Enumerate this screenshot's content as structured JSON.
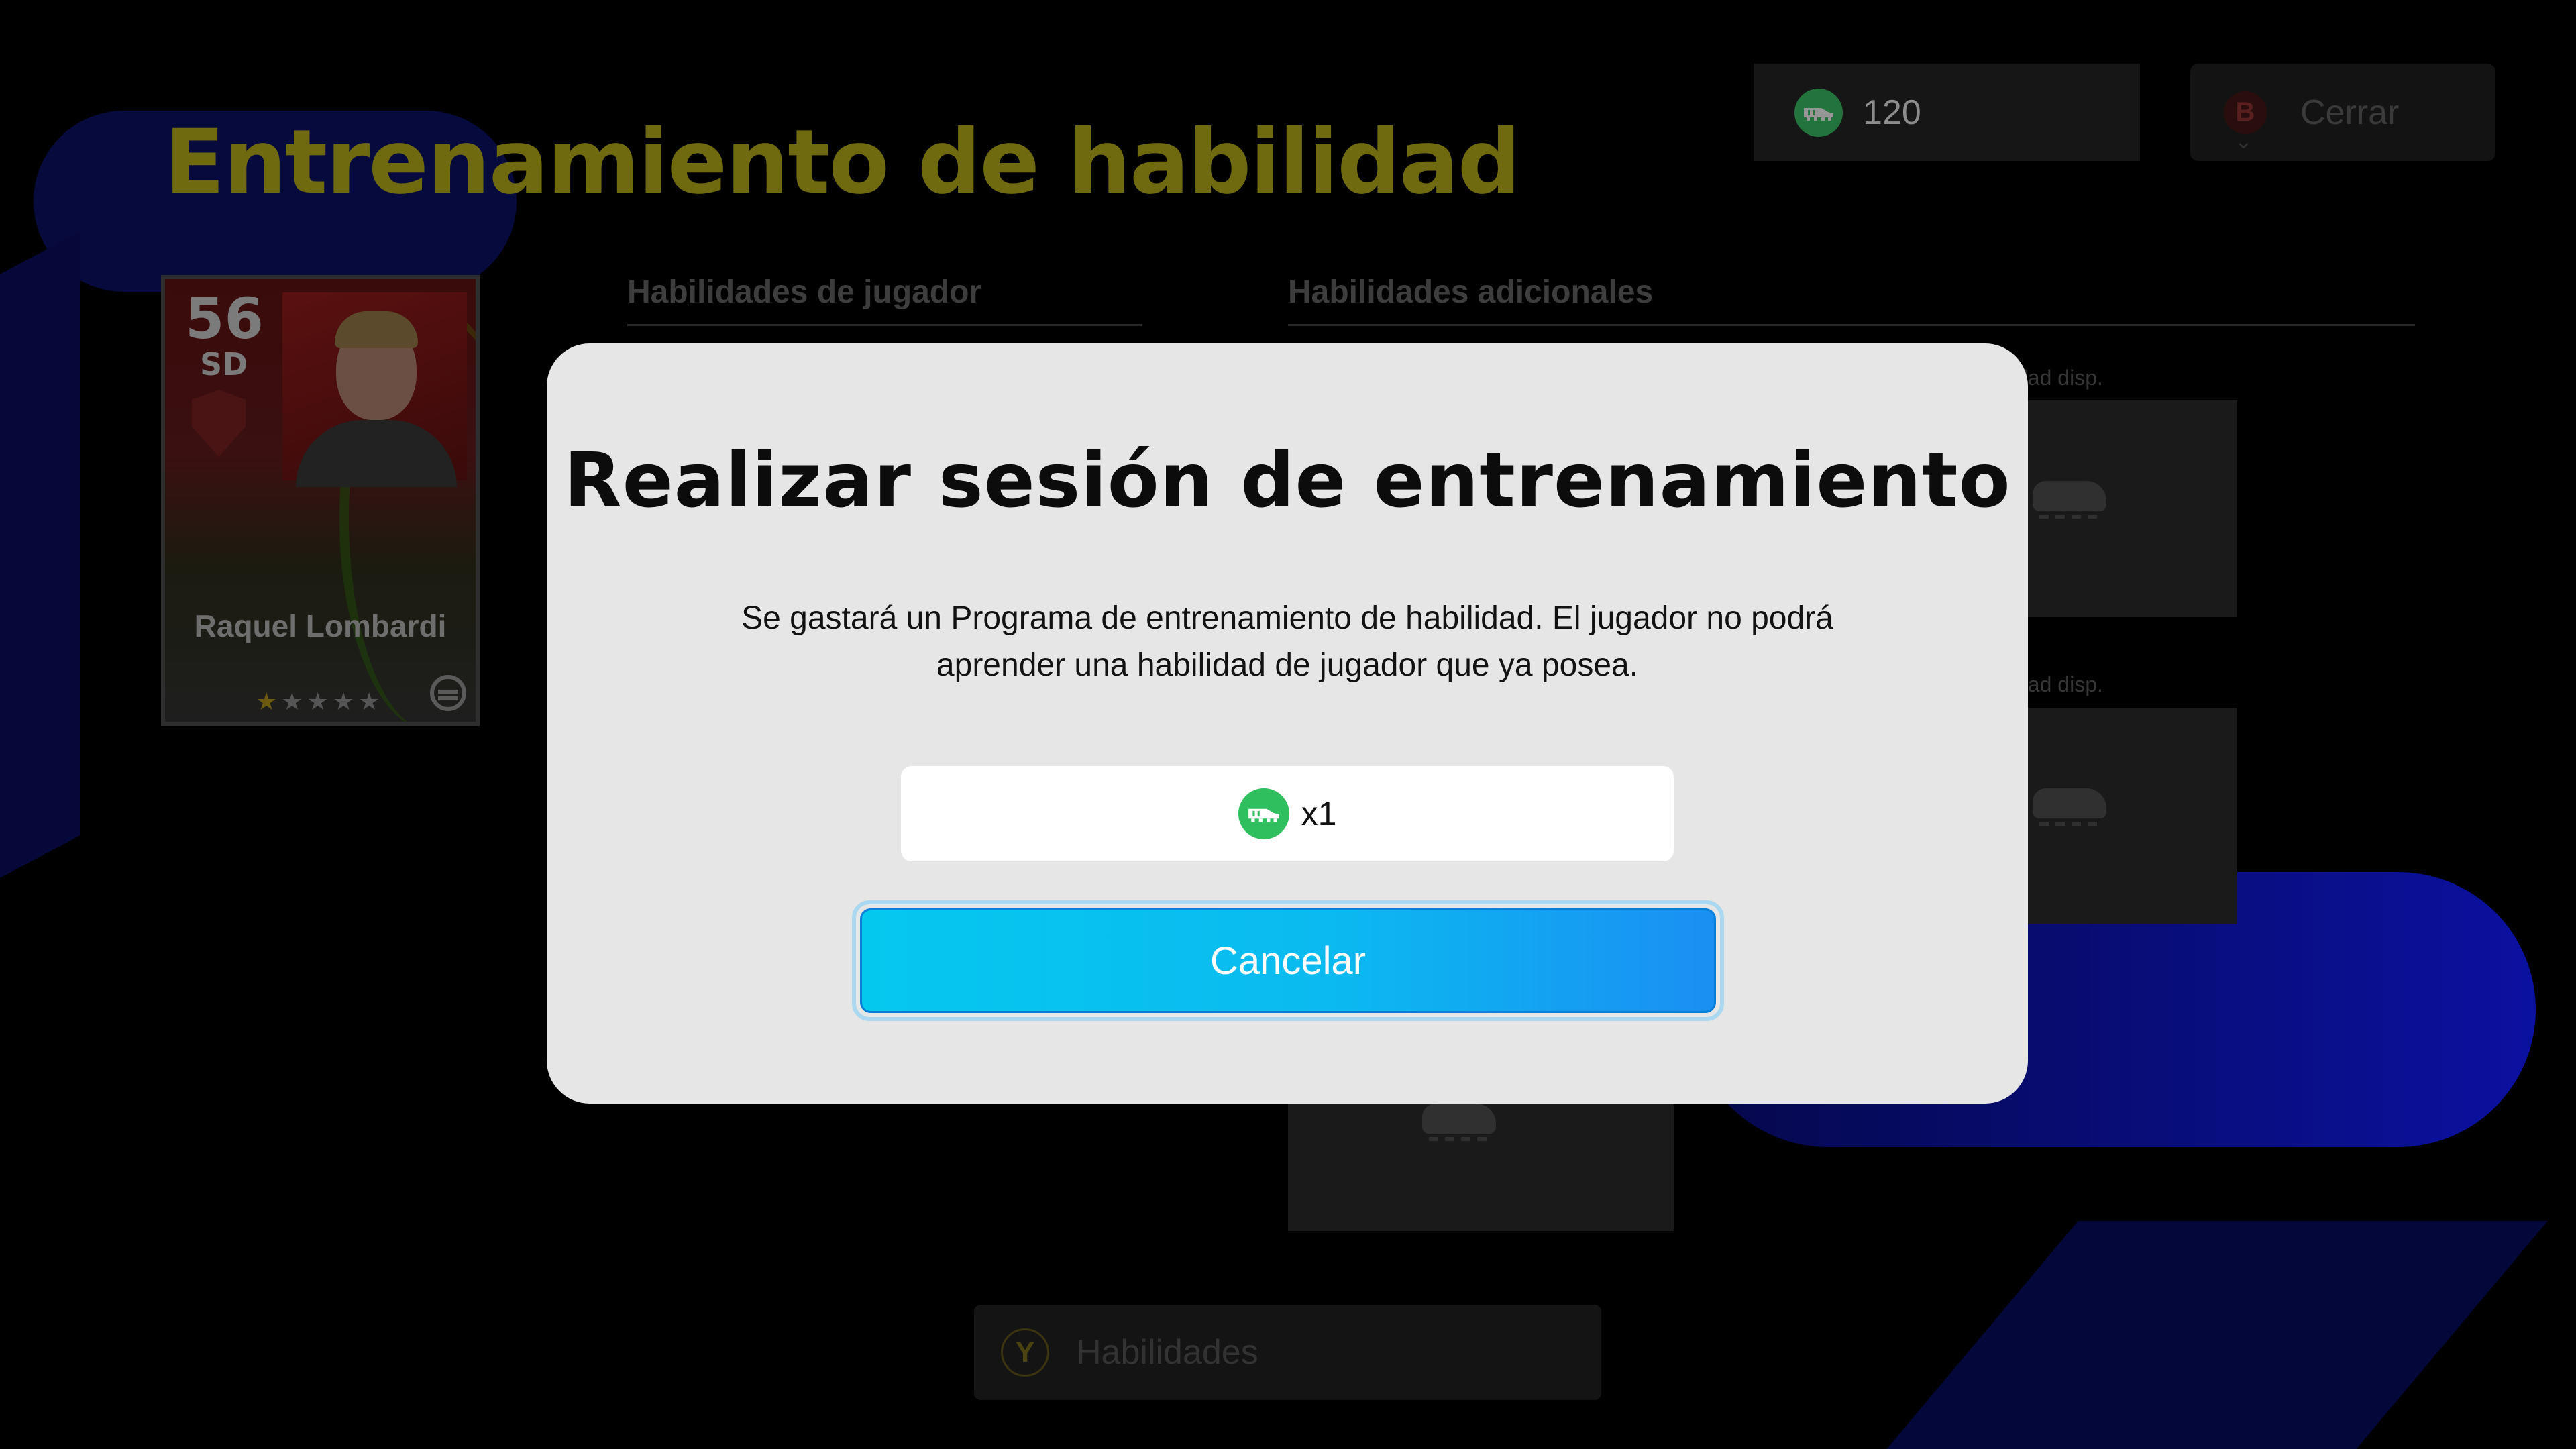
{
  "page": {
    "title": "Entrenamiento de habilidad",
    "accent_color": "#6f6a10"
  },
  "header": {
    "currency_icon": "skill-program-icon",
    "currency_value": "120",
    "close_button_key": "B",
    "close_button_label": "Cerrar"
  },
  "player_card": {
    "rating": "56",
    "position": "SD",
    "name": "Raquel Lombardi",
    "stars": "★★★★★",
    "stars_filled": 1,
    "stars_total": 5
  },
  "tabs": {
    "player_skills": "Habilidades de jugador",
    "additional_skills": "Habilidades adicionales"
  },
  "slots": {
    "available_label_1": "dad disp.",
    "available_label_2": "dad disp."
  },
  "footer": {
    "skills_button_key": "Y",
    "skills_button_label": "Habilidades"
  },
  "modal": {
    "title": "Realizar sesión de entrenamiento",
    "body": "Se gastará un Programa de entrenamiento de habilidad. El jugador no podrá aprender una habilidad de jugador que ya posea.",
    "cost_icon": "skill-program-icon",
    "cost_value": "x1",
    "cancel_label": "Cancelar",
    "cancel_color": "#05c8ef"
  }
}
